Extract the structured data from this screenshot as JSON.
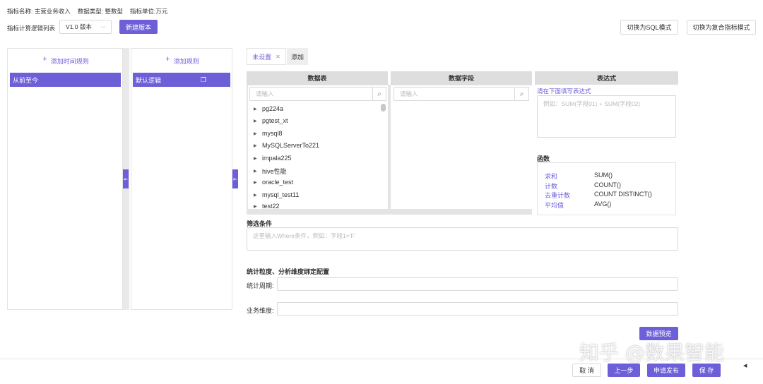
{
  "header": {
    "indicator_name": "指标名称: 主营业务收入",
    "data_type": "数据类型: 整数型",
    "unit": "指标单位:万元"
  },
  "version_bar": {
    "label": "指标计算逻辑列表",
    "selected_version": "V1.0 版本",
    "new_version_button": "新建版本",
    "sql_mode_button": "切换为SQL模式",
    "composite_mode_button": "切换为复合指标模式"
  },
  "time_rules": {
    "add_label": "添加时间规则",
    "items": [
      "从前至今"
    ]
  },
  "rules": {
    "add_label": "添加规则",
    "items": [
      "默认逻辑"
    ]
  },
  "tabs": {
    "items": [
      "未设置",
      "添加"
    ]
  },
  "columns": {
    "table_header": "数据表",
    "field_header": "数据字段",
    "expr_header": "表达式"
  },
  "search": {
    "table_placeholder": "请输入",
    "field_placeholder": "请输入"
  },
  "tables": [
    "pg224a",
    "pgtest_xt",
    "mysql8",
    "MySQLServerTo221",
    "impala225",
    "hive性能",
    "oracle_test",
    "mysql_test11",
    "test22"
  ],
  "expression": {
    "hint": "请在下面填写表达式",
    "placeholder": "例如：SUM(字段01) + SUM(字段02)"
  },
  "functions": {
    "title": "函数",
    "items": [
      {
        "name": "求和",
        "func": "SUM()"
      },
      {
        "name": "计数",
        "func": "COUNT()"
      },
      {
        "name": "去重计数",
        "func": "COUNT DISTINCT()"
      },
      {
        "name": "平均值",
        "func": "AVG()"
      }
    ]
  },
  "filter": {
    "title": "筛选条件",
    "placeholder": "这里输入Where条件，例如：字段1='F'"
  },
  "granularity": {
    "title": "统计粒度、分析维度绑定配置",
    "period_label": "统计周期:",
    "dimension_label": "业务维度:"
  },
  "preview_button": "数据预览",
  "footer": {
    "cancel": "取 消",
    "prev": "上一步",
    "publish": "申请发布",
    "save": "保 存"
  },
  "watermark": "知乎 @数果智能",
  "colors": {
    "accent": "#6c5fd8",
    "header_grey": "#dedede"
  }
}
